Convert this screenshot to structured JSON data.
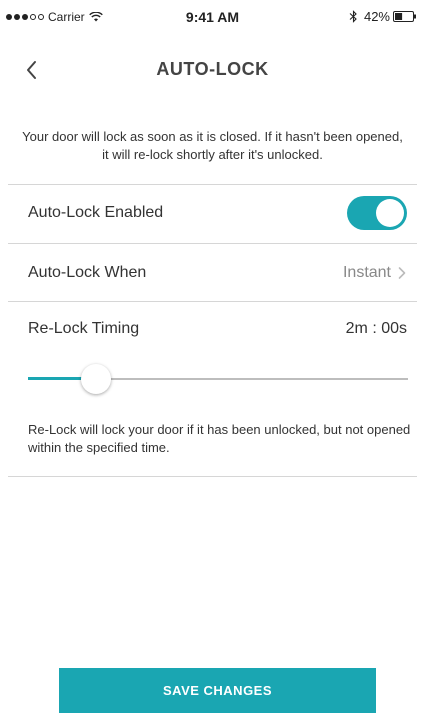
{
  "status_bar": {
    "signal_bars_filled": 3,
    "signal_bars_total": 5,
    "carrier": "Carrier",
    "time": "9:41 AM",
    "battery": "42%",
    "battery_level": 0.42
  },
  "nav": {
    "back_icon": "chevron-left-icon",
    "title": "AUTO-LOCK"
  },
  "intro": "Your door will lock as soon as it is closed. If it hasn't been opened, it will re-lock shortly after it's unlocked.",
  "settings": {
    "auto_lock_enabled": {
      "label": "Auto-Lock Enabled",
      "value": true
    },
    "auto_lock_when": {
      "label": "Auto-Lock When",
      "value": "Instant"
    },
    "relock_timing": {
      "label": "Re-Lock Timing",
      "value": "2m : 00s",
      "slider_fraction": 0.18
    }
  },
  "footnote": "Re-Lock will lock your door if it has been unlocked, but not opened within the specified time.",
  "save_label": "SAVE CHANGES",
  "colors": {
    "accent": "#1aa6b2",
    "divider": "#d6d6d6",
    "track": "#bdbdbd"
  }
}
